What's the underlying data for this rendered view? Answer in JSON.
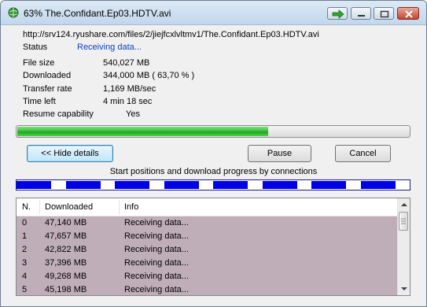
{
  "window": {
    "title": "63% The.Confidant.Ep03.HDTV.avi"
  },
  "details": {
    "url": "http://srv124.ryushare.com/files/2/jiejfcxlvltmv1/The.Confidant.Ep03.HDTV.avi",
    "status_label": "Status",
    "status_value": "Receiving data...",
    "file_size_label": "File size",
    "file_size_value": "540,027  MB",
    "downloaded_label": "Downloaded",
    "downloaded_value": "344,000  MB  ( 63,70 % )",
    "transfer_rate_label": "Transfer rate",
    "transfer_rate_value": "1,169  MB/sec",
    "time_left_label": "Time left",
    "time_left_value": "4 min  18 sec",
    "resume_label": "Resume capability",
    "resume_value": "Yes"
  },
  "progress": {
    "fraction": 0.637
  },
  "buttons": {
    "hide_details": "<< Hide details",
    "pause": "Pause",
    "cancel": "Cancel"
  },
  "connections": {
    "caption": "Start positions and download progress by connections",
    "segments": [
      [
        0.0,
        0.088
      ],
      [
        0.125,
        0.213
      ],
      [
        0.25,
        0.338
      ],
      [
        0.375,
        0.463
      ],
      [
        0.5,
        0.588
      ],
      [
        0.625,
        0.713
      ],
      [
        0.75,
        0.838
      ],
      [
        0.875,
        0.963
      ]
    ]
  },
  "colors": {
    "connection_fill": "#0000e6",
    "status_text": "#0a3fbf",
    "list_row_bg": "#bfaeb8"
  },
  "list": {
    "columns": [
      "N.",
      "Downloaded",
      "Info"
    ],
    "rows": [
      {
        "n": "0",
        "downloaded": "47,140  MB",
        "info": "Receiving data..."
      },
      {
        "n": "1",
        "downloaded": "47,657  MB",
        "info": "Receiving data..."
      },
      {
        "n": "2",
        "downloaded": "42,822  MB",
        "info": "Receiving data..."
      },
      {
        "n": "3",
        "downloaded": "37,396  MB",
        "info": "Receiving data..."
      },
      {
        "n": "4",
        "downloaded": "49,268  MB",
        "info": "Receiving data..."
      },
      {
        "n": "5",
        "downloaded": "45,198  MB",
        "info": "Receiving data..."
      }
    ]
  }
}
